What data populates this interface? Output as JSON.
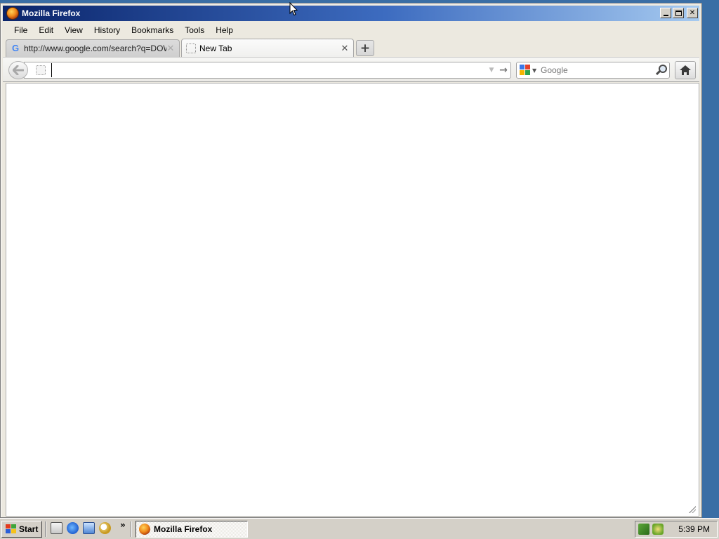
{
  "window": {
    "title": "Mozilla Firefox",
    "controls": {
      "minimize": "minimize",
      "maximize": "maximize",
      "close": "✕"
    }
  },
  "menubar": {
    "items": [
      "File",
      "Edit",
      "View",
      "History",
      "Bookmarks",
      "Tools",
      "Help"
    ]
  },
  "tabs": [
    {
      "label": "http://www.google.com/search?q=DOW...",
      "favicon": "google-g-icon",
      "favicon_text": "G",
      "active": false,
      "close": "✕"
    },
    {
      "label": "New Tab",
      "favicon": "blank-page-icon",
      "active": true,
      "close": "✕"
    }
  ],
  "new_tab_label": "+",
  "navbar": {
    "back": "🡐",
    "url_value": "",
    "dropmarker": "▼",
    "go": "→",
    "search_engine": "Google",
    "search_placeholder": "Google",
    "search_value": "",
    "engine_dropdown": "▼"
  },
  "taskbar": {
    "start_label": "Start",
    "quicklaunch_more": "»",
    "task_label": "Mozilla Firefox",
    "clock": "5:39 PM"
  },
  "colors": {
    "titlebar_start": "#0a246a",
    "titlebar_end": "#a6caf0",
    "chrome_bg": "#ece9e0",
    "taskbar_bg": "#d4d0c8"
  }
}
